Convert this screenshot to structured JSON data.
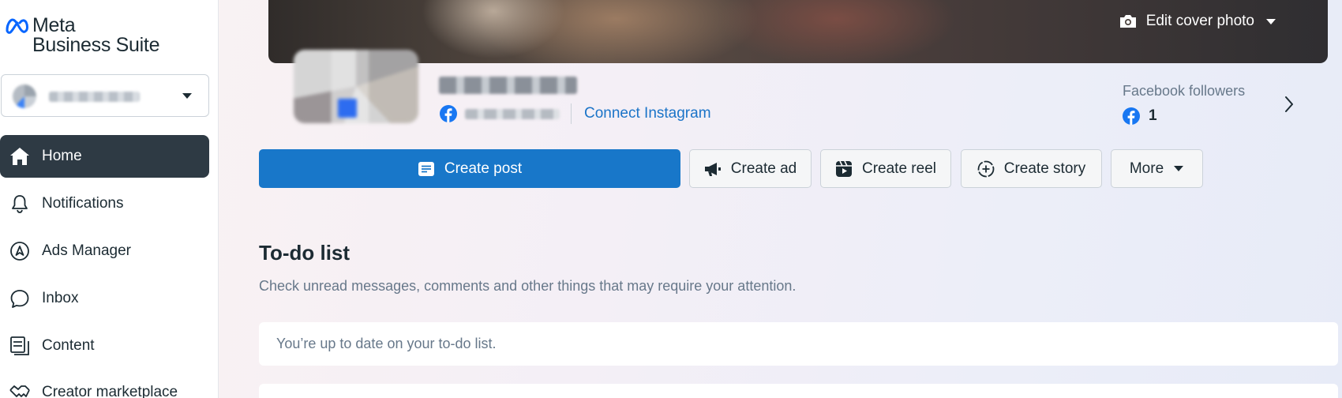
{
  "brand": {
    "name_line1": "Meta",
    "name_line2": "Business Suite"
  },
  "sidebar": {
    "items": [
      {
        "label": "Home",
        "icon": "home-icon",
        "active": true
      },
      {
        "label": "Notifications",
        "icon": "bell-icon",
        "active": false
      },
      {
        "label": "Ads Manager",
        "icon": "ads-manager-icon",
        "active": false
      },
      {
        "label": "Inbox",
        "icon": "chat-bubble-icon",
        "active": false
      },
      {
        "label": "Content",
        "icon": "content-icon",
        "active": false
      },
      {
        "label": "Creator marketplace",
        "icon": "handshake-icon",
        "active": false
      }
    ]
  },
  "cover": {
    "edit_label": "Edit cover photo"
  },
  "profile": {
    "connect_label": "Connect Instagram"
  },
  "followers": {
    "label": "Facebook followers",
    "count": "1"
  },
  "actions": {
    "create_post": "Create post",
    "create_ad": "Create ad",
    "create_reel": "Create reel",
    "create_story": "Create story",
    "more": "More"
  },
  "todo": {
    "title": "To-do list",
    "subtitle": "Check unread messages, comments and other things that may require your attention.",
    "empty_message": "You’re up to date on your to-do list."
  },
  "colors": {
    "primary": "#1877c9",
    "active_nav": "#2e3a44",
    "facebook_blue": "#1877f2"
  }
}
